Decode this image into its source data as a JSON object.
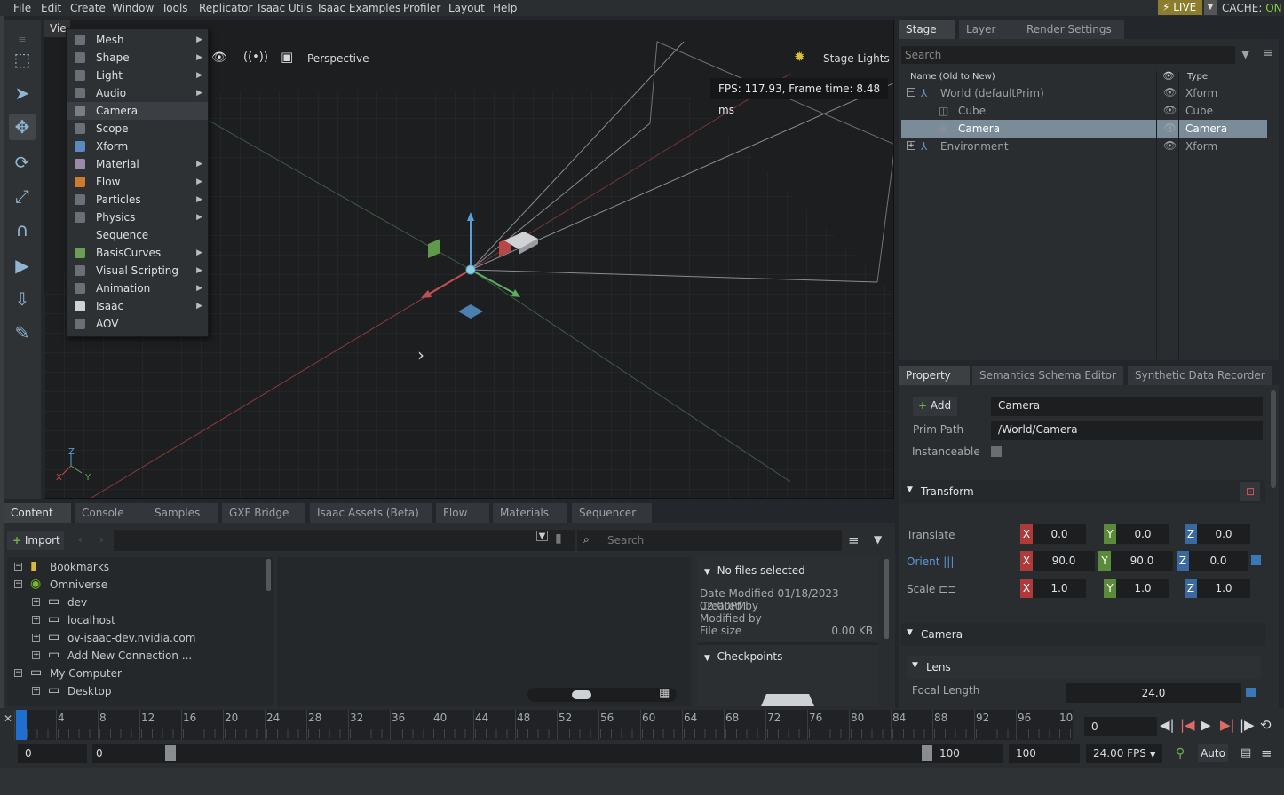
{
  "menubar": {
    "items": [
      "File",
      "Edit",
      "Create",
      "Window",
      "Tools",
      "Replicator",
      "Isaac Utils",
      "Isaac Examples",
      "Profiler",
      "Layout",
      "Help"
    ],
    "live_label": "LIVE",
    "cache_label": "CACHE:",
    "cache_state": "ON"
  },
  "viewport": {
    "tab_label": "Vie",
    "camera_label": "Perspective",
    "lights_label": "Stage Lights",
    "fps_text": "FPS: 117.93, Frame time: 8.48 ms",
    "axis_labels": {
      "z": "Z",
      "x": "X",
      "y": "Y"
    }
  },
  "create_menu": {
    "items": [
      {
        "label": "Mesh",
        "submenu": true,
        "icon": "cube-icon"
      },
      {
        "label": "Shape",
        "submenu": true,
        "icon": "shape-icon"
      },
      {
        "label": "Light",
        "submenu": true,
        "icon": "light-icon"
      },
      {
        "label": "Audio",
        "submenu": true,
        "icon": "speaker-icon"
      },
      {
        "label": "Camera",
        "submenu": false,
        "icon": "camera-icon",
        "highlighted": true
      },
      {
        "label": "Scope",
        "submenu": false,
        "icon": "folder-icon"
      },
      {
        "label": "Xform",
        "submenu": false,
        "icon": "xform-icon"
      },
      {
        "label": "Material",
        "submenu": true,
        "icon": "sphere-icon"
      },
      {
        "label": "Flow",
        "submenu": true,
        "icon": "flame-icon"
      },
      {
        "label": "Particles",
        "submenu": true,
        "icon": "particles-icon"
      },
      {
        "label": "Physics",
        "submenu": true,
        "icon": "physics-icon"
      },
      {
        "label": "Sequence",
        "submenu": false,
        "icon": ""
      },
      {
        "label": "BasisCurves",
        "submenu": true,
        "icon": "curve-icon"
      },
      {
        "label": "Visual Scripting",
        "submenu": true,
        "icon": "graph-icon"
      },
      {
        "label": "Animation",
        "submenu": true,
        "icon": "animation-icon"
      },
      {
        "label": "Isaac",
        "submenu": true,
        "icon": "isaac-icon"
      },
      {
        "label": "AOV",
        "submenu": false,
        "icon": "image-icon"
      }
    ]
  },
  "stage": {
    "tabs": [
      "Stage",
      "Layer",
      "Render Settings"
    ],
    "search_placeholder": "Search",
    "col_name": "Name (Old to New)",
    "col_type": "Type",
    "rows": [
      {
        "name": "World (defaultPrim)",
        "type": "Xform",
        "indent": 0,
        "expand": "−",
        "selected": false
      },
      {
        "name": "Cube",
        "type": "Cube",
        "indent": 1,
        "expand": "",
        "selected": false
      },
      {
        "name": "Camera",
        "type": "Camera",
        "indent": 1,
        "expand": "",
        "selected": true
      },
      {
        "name": "Environment",
        "type": "Xform",
        "indent": 0,
        "expand": "+",
        "selected": false
      }
    ]
  },
  "property": {
    "tabs": [
      "Property",
      "Semantics Schema Editor",
      "Synthetic Data Recorder"
    ],
    "add_label": "Add",
    "prim_name": "Camera",
    "prim_path_label": "Prim Path",
    "prim_path": "/World/Camera",
    "instanceable_label": "Instanceable",
    "transform_label": "Transform",
    "translate_label": "Translate",
    "orient_label": "Orient",
    "scale_label": "Scale",
    "translate": {
      "x": "0.0",
      "y": "0.0",
      "z": "0.0"
    },
    "orient": {
      "x": "90.0",
      "y": "90.0",
      "z": "0.0"
    },
    "scale": {
      "x": "1.0",
      "y": "1.0",
      "z": "1.0"
    },
    "camera_label": "Camera",
    "lens_label": "Lens",
    "focal_length_label": "Focal Length",
    "focal_length": "24.0"
  },
  "content": {
    "tabs": [
      "Content",
      "Console",
      "Samples",
      "GXF Bridge",
      "Isaac Assets (Beta)",
      "Flow",
      "Materials",
      "Sequencer"
    ],
    "import_label": "Import",
    "search_placeholder": "Search",
    "tree": [
      {
        "label": "Bookmarks",
        "indent": 0,
        "expand": "−",
        "icon": "bookmark-icon"
      },
      {
        "label": "Omniverse",
        "indent": 0,
        "expand": "−",
        "icon": "omniverse-icon"
      },
      {
        "label": "dev",
        "indent": 1,
        "expand": "+",
        "icon": "server-icon"
      },
      {
        "label": "localhost",
        "indent": 1,
        "expand": "+",
        "icon": "server-icon"
      },
      {
        "label": "ov-isaac-dev.nvidia.com",
        "indent": 1,
        "expand": "+",
        "icon": "server-icon"
      },
      {
        "label": "Add New Connection ...",
        "indent": 1,
        "expand": "+",
        "icon": "server-add-icon"
      },
      {
        "label": "My Computer",
        "indent": 0,
        "expand": "−",
        "icon": "computer-icon"
      },
      {
        "label": "Desktop",
        "indent": 1,
        "expand": "+",
        "icon": "server-icon"
      }
    ],
    "info_title": "No files selected",
    "date_modified_label": "Date Modified",
    "date_modified": "01/18/2023 02:00PM",
    "created_by_label": "Created by",
    "modified_by_label": "Modified by",
    "file_size_label": "File size",
    "file_size": "0.00 KB",
    "checkpoints_label": "Checkpoints"
  },
  "timeline": {
    "ticks": [
      "0",
      "4",
      "8",
      "12",
      "16",
      "20",
      "24",
      "28",
      "32",
      "36",
      "40",
      "44",
      "48",
      "52",
      "56",
      "60",
      "64",
      "68",
      "72",
      "76",
      "80",
      "84",
      "88",
      "92",
      "96",
      "10"
    ],
    "current_frame": "0",
    "start": "0",
    "range_start": "0",
    "range_end": "100",
    "end": "100",
    "fps": "24.00 FPS",
    "auto_label": "Auto"
  }
}
